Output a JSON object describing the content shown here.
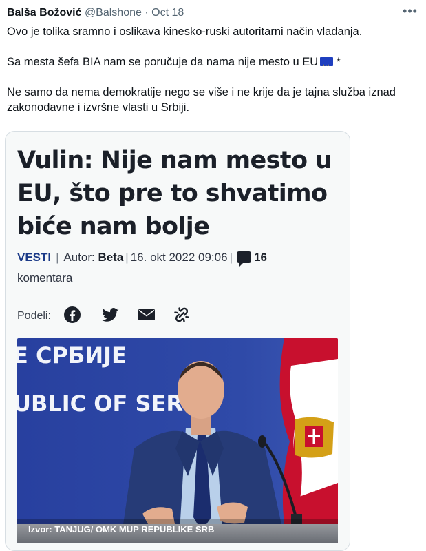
{
  "tweet": {
    "author_name": "Balša Božović",
    "handle": "@Balshone",
    "separator": "·",
    "date": "Oct 18",
    "more_label": "•••",
    "paragraph1": "Ovo je tolika sramno i oslikava kinesko-ruski autoritarni način vladanja.",
    "paragraph2": "Sa mesta šefa BIA nam se poručuje da nama nije mesto u EU",
    "paragraph2_suffix": "*",
    "paragraph3": "Ne samo da nema demokratije nego se više i ne krije da je tajna služba iznad zakonodavne i izvršne vlasti u Srbiji."
  },
  "article": {
    "headline": "Vulin: Nije nam mesto u EU, što pre to shvatimo biće nam bolje",
    "category": "VESTI",
    "divider": "|",
    "author_label": "Autor:",
    "author": "Beta",
    "datetime": "16. okt 2022 09:06",
    "comments_count": "16",
    "comments_label": "komentara",
    "share_label": "Podeli:",
    "share_icons": [
      "facebook-icon",
      "twitter-icon",
      "email-icon",
      "link-icon"
    ],
    "photo": {
      "banner_line1": "Е СРБИЈЕ",
      "banner_line2": "UBLIC OF SERB",
      "caption": "Izvor: TANJUG/ OMK MUP REPUBLIKE SRB"
    }
  },
  "colors": {
    "text": "#0f1419",
    "muted": "#536471",
    "category": "#1b3a88",
    "backdrop_blue": "#2a3f9e"
  }
}
